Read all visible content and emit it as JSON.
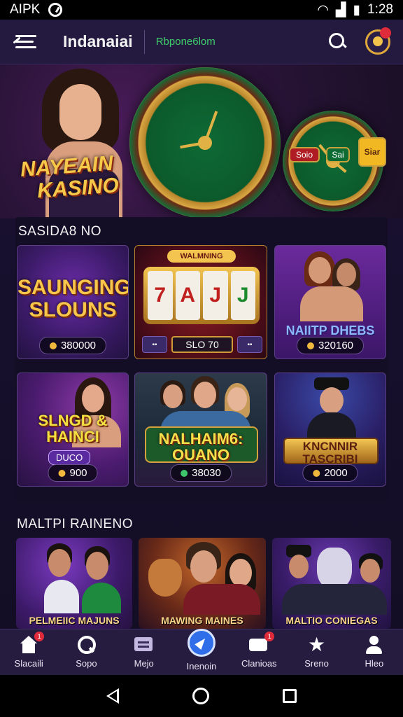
{
  "status_bar": {
    "carrier": "AIPK",
    "time": "1:28"
  },
  "app_bar": {
    "title": "Indanaiai",
    "subtitle": "Rbpone6lom"
  },
  "hero": {
    "brand_line1": "NAYEAIN",
    "brand_line2": "KASINO",
    "chip_red": "Soio",
    "chip_green": "Sai",
    "chip_gold": "Siar"
  },
  "sections": {
    "featured_title": "SASIDA8 NO",
    "more_title": "MALTPI RAINENO"
  },
  "games": [
    {
      "title": "SAUNGING SLOUNS",
      "value": "380000"
    },
    {
      "title": "WALMNING",
      "value": "SLO 70",
      "reels": [
        "7",
        "A",
        "J",
        "J"
      ]
    },
    {
      "title": "NAIITP DHEBS",
      "value": "320160"
    },
    {
      "title": "SLNGD & HAINCI",
      "subtitle": "DUCO",
      "value": "900"
    },
    {
      "title": "NALHAIM6: OUANO",
      "value": "38030"
    },
    {
      "title": "KNCNNIR TASCRIBI",
      "value": "2000"
    }
  ],
  "more_games": [
    {
      "label": "PELMEIIC MAJUNS"
    },
    {
      "label": "MAWING MAINES"
    },
    {
      "label": "MALTIO CONIEGAS"
    }
  ],
  "bottom_nav": [
    {
      "label": "Slacaili",
      "icon": "home-icon",
      "badge": "1"
    },
    {
      "label": "Sopo",
      "icon": "search-icon"
    },
    {
      "label": "Mejo",
      "icon": "message-icon"
    },
    {
      "label": "Inenoin",
      "icon": "compass-icon"
    },
    {
      "label": "Clanioas",
      "icon": "channel-icon",
      "badge": "1"
    },
    {
      "label": "Sreno",
      "icon": "star-icon"
    },
    {
      "label": "Hleo",
      "icon": "user-icon"
    }
  ],
  "colors": {
    "accent_gold": "#f8c64a",
    "brand_green": "#3ecf6a",
    "nav_bg": "#261c40"
  }
}
